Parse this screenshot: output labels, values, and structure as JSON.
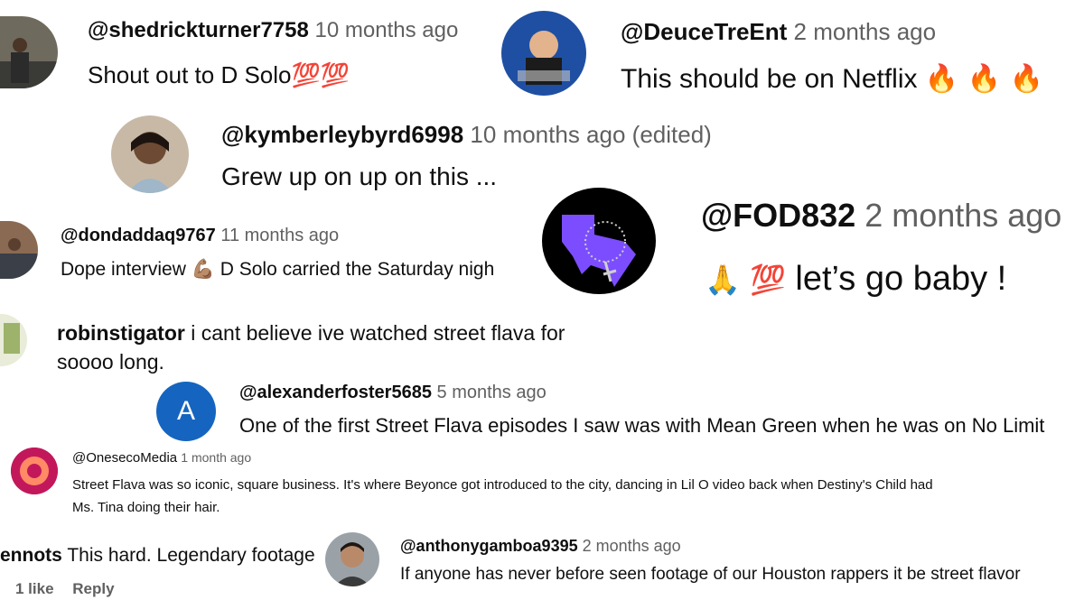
{
  "comments": [
    {
      "handle": "@shedrickturner7758",
      "time": "10 months ago",
      "text": "Shout out to D Solo",
      "emoji": "💯💯"
    },
    {
      "handle": "@DeuceTreEnt",
      "time": "2 months ago",
      "text": "This should be on Netflix",
      "emoji": "🔥 🔥 🔥"
    },
    {
      "handle": "@kymberleybyrd6998",
      "time": "10 months ago (edited)",
      "text": "Grew up on up on this ..."
    },
    {
      "handle": "@dondaddaq9767",
      "time": "11 months ago",
      "text_a": "Dope interview",
      "emoji": "💪🏽",
      "text_b": "D Solo carried the Saturday nigh"
    },
    {
      "handle": "@FOD832",
      "time": "2 months ago",
      "emoji": "🙏 💯",
      "text": "let’s go baby !"
    },
    {
      "handle": "robinstigator",
      "text_line1": "i cant believe ive watched street flava for",
      "text_line2": "soooo long."
    },
    {
      "handle": "@alexanderfoster5685",
      "time": "5 months ago",
      "avatar_letter": "A",
      "text": "One of the first Street Flava episodes I saw was with Mean Green when he was on No Limit"
    },
    {
      "handle": "@OnesecoMedia",
      "time": "1 month ago",
      "text_line1": "Street Flava was so iconic, square business. It's where Beyonce got introduced to the city, dancing in Lil O video back when Destiny's Child had",
      "text_line2": "Ms. Tina doing their hair."
    },
    {
      "handle": "ennots",
      "text": "This hard. Legendary footage",
      "likes": "1 like",
      "reply": "Reply"
    },
    {
      "handle": "@anthonygamboa9395",
      "time": "2 months ago",
      "text": "If anyone has never before seen footage of our Houston rappers it be street flavor"
    }
  ],
  "colors": {
    "handle": "#0f0f0f",
    "time": "#606060",
    "avatar_blue": "#1565c0"
  }
}
